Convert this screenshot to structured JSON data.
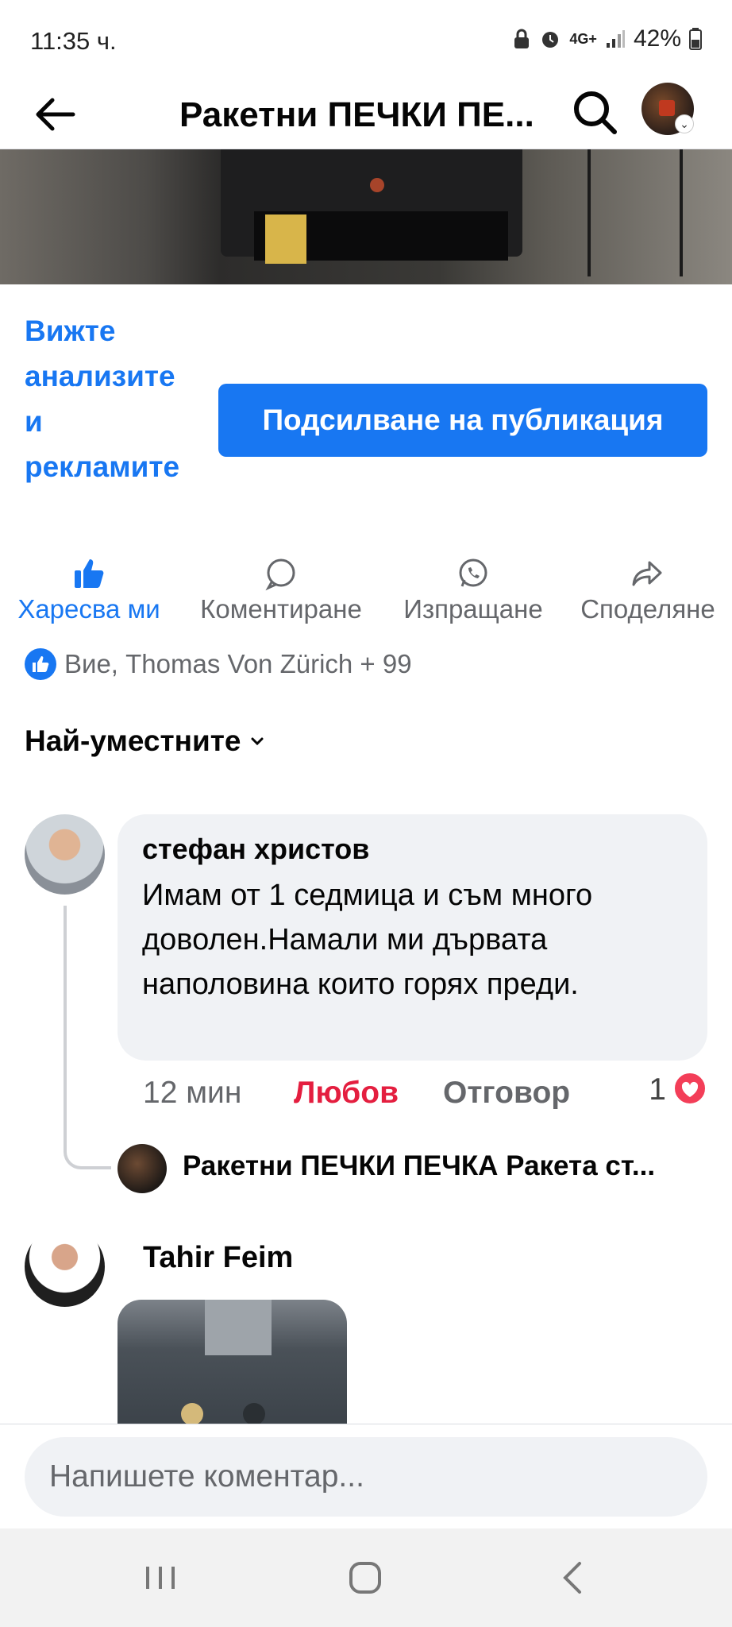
{
  "status_bar": {
    "time": "11:35 ч.",
    "network": "4G+",
    "battery": "42%"
  },
  "header": {
    "title": "Ракетни ПЕЧКИ ПЕ...",
    "back_icon": "back-arrow-icon",
    "search_icon": "search-icon"
  },
  "promo": {
    "insights_link": "Вижте анализите и рекламите",
    "boost_button": "Подсилване на публикация",
    "accent_color": "#1877f2"
  },
  "actions": {
    "like": "Харесва ми",
    "comment": "Коментиране",
    "send": "Изпращане",
    "share": "Споделяне"
  },
  "reactions": {
    "text": "Вие, Thomas Von Zürich + 99"
  },
  "comments_sort": {
    "label": "Най-уместните"
  },
  "comments": [
    {
      "author": "стефан христов",
      "text": "Имам  от 1 седмица  и  съм много доволен.Намали ми дървата наполовина които горях преди.",
      "time": "12 мин",
      "reaction_label": "Любов",
      "reply_label": "Отговор",
      "reaction_count": "1",
      "reply_preview": "Ракетни ПЕЧКИ ПЕЧКА Ракета ст..."
    },
    {
      "author": "Tahir Feim"
    }
  ],
  "composer": {
    "placeholder": "Напишете коментар..."
  }
}
